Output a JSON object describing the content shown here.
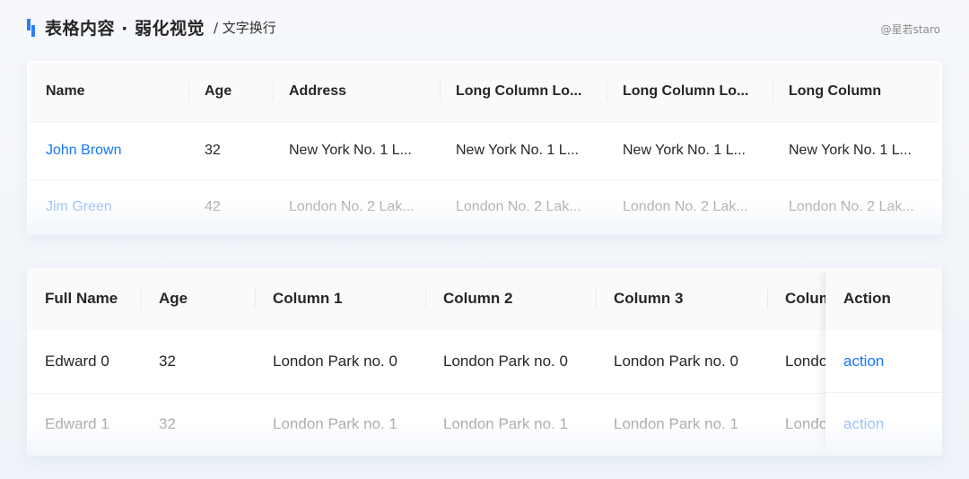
{
  "header": {
    "title": "表格内容 · 弱化视觉",
    "subtitle": "/ 文字换行",
    "watermark": "@星若staro"
  },
  "colors": {
    "accent": "#1677ff",
    "accent_faded": "#91bdf8",
    "logo": "#2f7cf6"
  },
  "table1": {
    "columns": [
      "Name",
      "Age",
      "Address",
      "Long Column Lo...",
      "Long Column Lo...",
      "Long Column"
    ],
    "rows": [
      [
        "John Brown",
        "32",
        "New York No. 1 L...",
        "New York No. 1 L...",
        "New York No. 1 L...",
        "New York No. 1 L..."
      ],
      [
        "Jim Green",
        "42",
        "London No. 2 Lak...",
        "London No. 2 Lak...",
        "London No. 2 Lak...",
        "London No. 2 Lak..."
      ]
    ]
  },
  "table2": {
    "columns": [
      "Full Name",
      "Age",
      "Column 1",
      "Column 2",
      "Column 3",
      "Column"
    ],
    "fixed_column": "Action",
    "rows": [
      [
        "Edward 0",
        "32",
        "London Park no. 0",
        "London Park no. 0",
        "London Park no. 0",
        "London"
      ],
      [
        "Edward 1",
        "32",
        "London Park no. 1",
        "London Park no. 1",
        "London Park no. 1",
        "London"
      ]
    ],
    "action_label": "action"
  }
}
